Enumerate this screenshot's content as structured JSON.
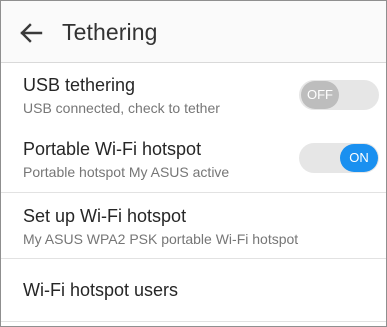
{
  "header": {
    "title": "Tethering"
  },
  "settings": [
    {
      "title": "USB tethering",
      "subtitle": "USB connected, check to tether",
      "toggle": "OFF"
    },
    {
      "title": "Portable Wi-Fi hotspot",
      "subtitle": "Portable hotspot My ASUS active",
      "toggle": "ON"
    },
    {
      "title": "Set up Wi-Fi hotspot",
      "subtitle": "My ASUS WPA2 PSK portable Wi-Fi hotspot"
    },
    {
      "title": "Wi-Fi hotspot users"
    }
  ],
  "icons": {
    "back": "arrow-left"
  },
  "colors": {
    "toggle_on": "#1a90f0",
    "toggle_off_knob": "#bdbdbd",
    "track": "#e6e6e6"
  }
}
